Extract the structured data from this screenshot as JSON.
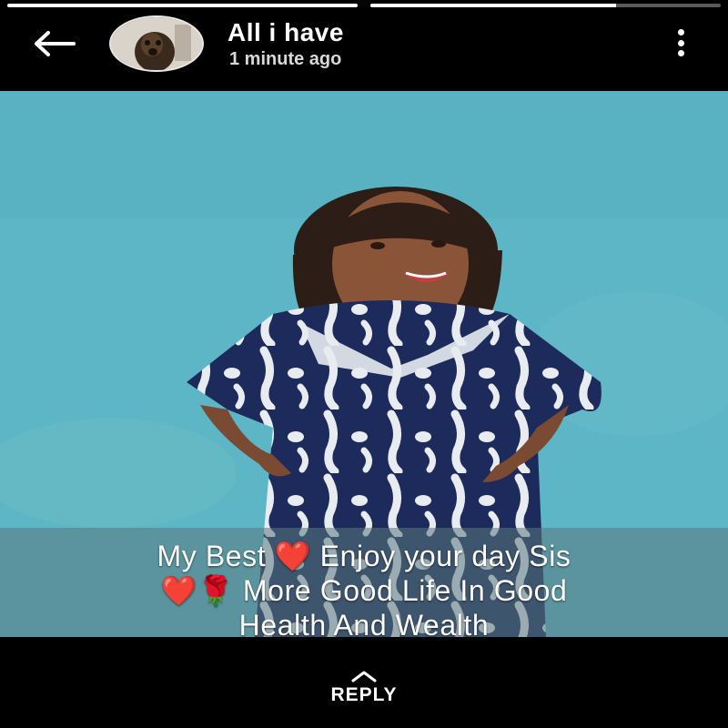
{
  "status": {
    "progress": [
      1.0,
      0.7
    ]
  },
  "header": {
    "title": "All i have",
    "time": "1 minute ago",
    "back_icon": "arrow-left-icon",
    "more_icon": "more-vertical-icon"
  },
  "caption": {
    "line1": "My Best ❤️ Enjoy your day Sis",
    "line2": "❤️🌹  More Good Life In Good",
    "line3": "Health And Wealth"
  },
  "footer": {
    "reply_label": "REPLY",
    "reply_icon": "chevron-up-icon"
  },
  "colors": {
    "background": "#000000",
    "wall": "#5fb8c8",
    "dress": "#1d2a5c"
  }
}
